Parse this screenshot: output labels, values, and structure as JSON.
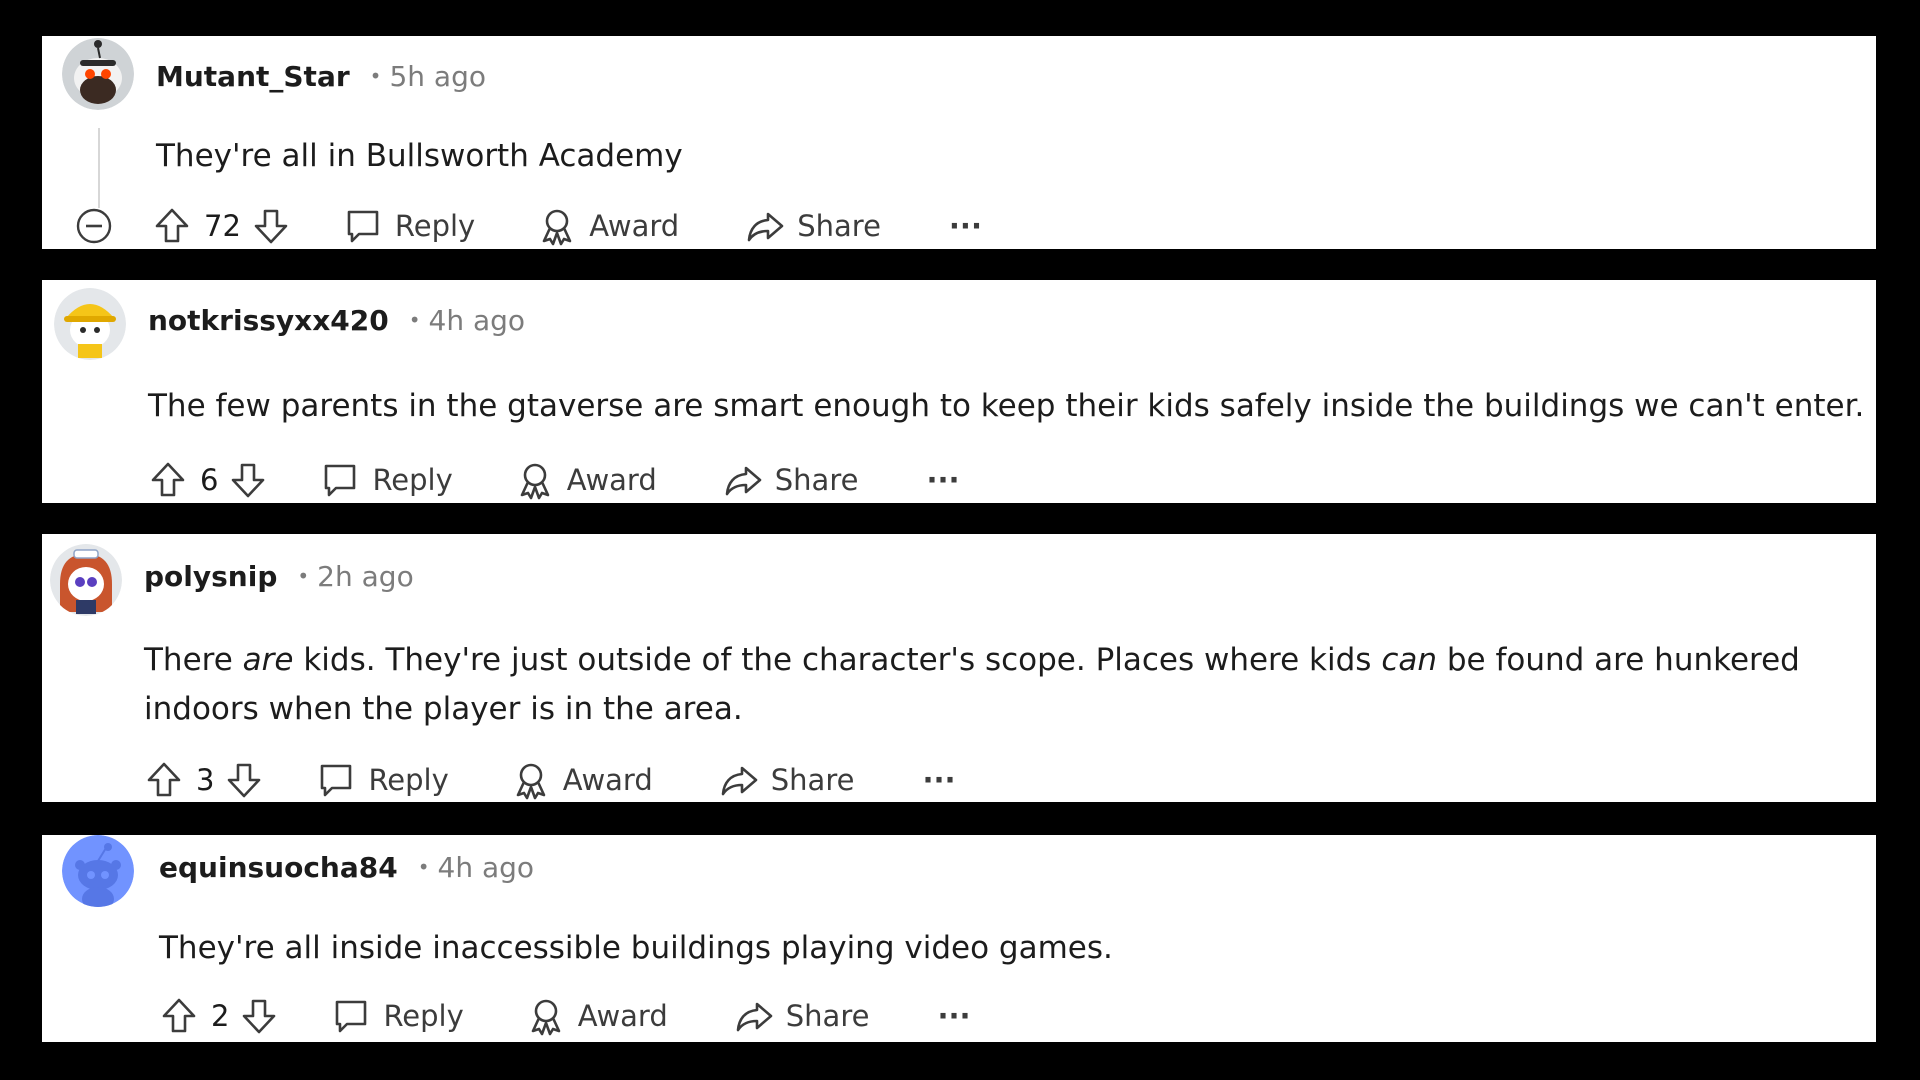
{
  "labels": {
    "reply": "Reply",
    "award": "Award",
    "share": "Share",
    "more": "···",
    "separator": "•"
  },
  "comments": [
    {
      "username": "Mutant_Star",
      "time": "5h ago",
      "text": "They're all in Bullsworth Academy",
      "votes": "72",
      "avatar": "snoo-with-beard-avatar",
      "collapse_icon": "collapse-thread-icon"
    },
    {
      "username": "notkrissyxx420",
      "time": "4h ago",
      "text": "The few parents in the gtaverse are smart enough to keep their kids safely inside the buildings we can't enter.",
      "votes": "6",
      "avatar": "snoo-yellow-hat-avatar"
    },
    {
      "username": "polysnip",
      "time": "2h ago",
      "text_parts": [
        "There ",
        "are",
        " kids. They're just outside of the character's scope. Places where kids ",
        "can",
        " be found are hunkered"
      ],
      "text_line2": "indoors when the player is in the area.",
      "votes": "3",
      "avatar": "snoo-red-hair-avatar"
    },
    {
      "username": "equinsuocha84",
      "time": "4h ago",
      "text": "They're all inside inaccessible buildings playing video games.",
      "votes": "2",
      "avatar": "default-snoo-avatar"
    }
  ],
  "colors": {
    "background": "#000000",
    "card": "#ffffff",
    "text": "#1c1c1c",
    "muted": "#7c7c7c",
    "action": "#3c3c3c"
  }
}
